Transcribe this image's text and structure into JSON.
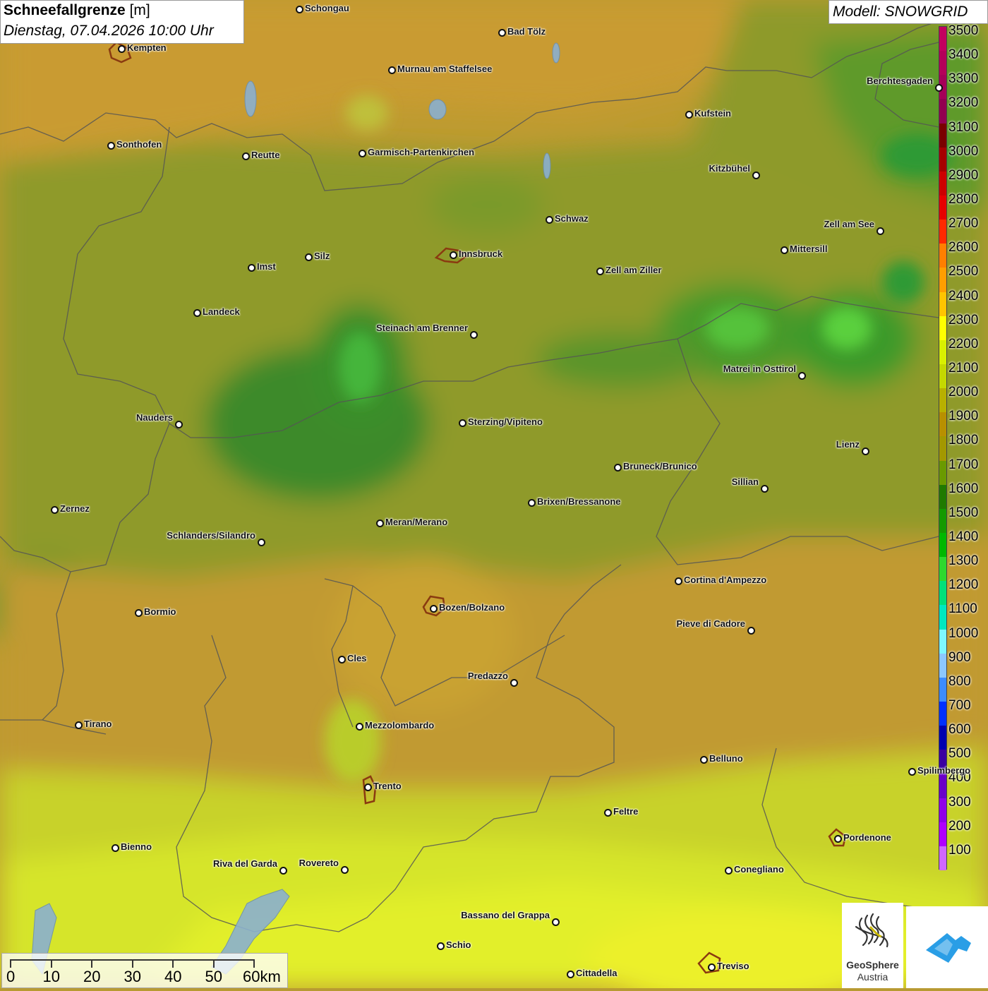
{
  "header": {
    "title": "Schneefallgrenze",
    "unit": "[m]",
    "datetime": "Dienstag, 07.04.2026 10:00 Uhr"
  },
  "model": {
    "label": "Modell: SNOWGRID"
  },
  "legend": {
    "labels": [
      "3500",
      "3400",
      "3300",
      "3200",
      "3100",
      "3000",
      "2900",
      "2800",
      "2700",
      "2600",
      "2500",
      "2400",
      "2300",
      "2200",
      "2100",
      "2000",
      "1900",
      "1800",
      "1700",
      "1600",
      "1500",
      "1400",
      "1300",
      "1200",
      "1100",
      "1000",
      "900",
      "800",
      "700",
      "600",
      "500",
      "400",
      "300",
      "200",
      "100"
    ],
    "colors": [
      "#c2005f",
      "#b4005a",
      "#a50058",
      "#920050",
      "#7a0000",
      "#a60000",
      "#cc0000",
      "#e60000",
      "#ff2a00",
      "#ff7f00",
      "#ff9e00",
      "#ffc400",
      "#ffff00",
      "#d8f000",
      "#c4d800",
      "#b8b000",
      "#b89000",
      "#a39800",
      "#6a9a00",
      "#207a00",
      "#149a00",
      "#00b800",
      "#2ed82e",
      "#00e07a",
      "#00e8c0",
      "#7ef8ff",
      "#8cc8ff",
      "#3c8cff",
      "#0030ff",
      "#0000b0",
      "#3a00a0",
      "#6a00c8",
      "#9000e8",
      "#b000ff",
      "#d066ff"
    ]
  },
  "cities": [
    {
      "name": "Schongau",
      "pos": "right"
    },
    {
      "name": "Bad Tölz",
      "pos": "right"
    },
    {
      "name": "Kempten",
      "pos": "right"
    },
    {
      "name": "Murnau am Staffelsee",
      "pos": "right"
    },
    {
      "name": "Berchtesgaden",
      "pos": "left"
    },
    {
      "name": "Kufstein",
      "pos": "right"
    },
    {
      "name": "Sonthofen",
      "pos": "right"
    },
    {
      "name": "Reutte",
      "pos": "right"
    },
    {
      "name": "Garmisch-Partenkirchen",
      "pos": "right"
    },
    {
      "name": "Kitzbühel",
      "pos": "left"
    },
    {
      "name": "Schwaz",
      "pos": "right"
    },
    {
      "name": "Zell am See",
      "pos": "left"
    },
    {
      "name": "Innsbruck",
      "pos": "right"
    },
    {
      "name": "Silz",
      "pos": "right"
    },
    {
      "name": "Mittersill",
      "pos": "right"
    },
    {
      "name": "Imst",
      "pos": "right"
    },
    {
      "name": "Zell am Ziller",
      "pos": "right"
    },
    {
      "name": "Landeck",
      "pos": "right"
    },
    {
      "name": "Steinach am Brenner",
      "pos": "left"
    },
    {
      "name": "Matrei in Osttirol",
      "pos": "left"
    },
    {
      "name": "Nauders",
      "pos": "left"
    },
    {
      "name": "Sterzing/Vipiteno",
      "pos": "right"
    },
    {
      "name": "Lienz",
      "pos": "left"
    },
    {
      "name": "Bruneck/Brunico",
      "pos": "right"
    },
    {
      "name": "Sillian",
      "pos": "left"
    },
    {
      "name": "Zernez",
      "pos": "right"
    },
    {
      "name": "Brixen/Bressanone",
      "pos": "right"
    },
    {
      "name": "Meran/Merano",
      "pos": "right"
    },
    {
      "name": "Schlanders/Silandro",
      "pos": "left"
    },
    {
      "name": "Cortina d'Ampezzo",
      "pos": "right"
    },
    {
      "name": "Bozen/Bolzano",
      "pos": "right"
    },
    {
      "name": "Bormio",
      "pos": "right"
    },
    {
      "name": "Pieve di Cadore",
      "pos": "left"
    },
    {
      "name": "Cles",
      "pos": "right"
    },
    {
      "name": "Predazzo",
      "pos": "left"
    },
    {
      "name": "Tirano",
      "pos": "right"
    },
    {
      "name": "Mezzolombardo",
      "pos": "right"
    },
    {
      "name": "Belluno",
      "pos": "right"
    },
    {
      "name": "Spilimbergo",
      "pos": "right"
    },
    {
      "name": "Trento",
      "pos": "right"
    },
    {
      "name": "Feltre",
      "pos": "right"
    },
    {
      "name": "Pordenone",
      "pos": "right"
    },
    {
      "name": "Bienno",
      "pos": "right"
    },
    {
      "name": "Riva del Garda",
      "pos": "left"
    },
    {
      "name": "Rovereto",
      "pos": "left"
    },
    {
      "name": "Conegliano",
      "pos": "right"
    },
    {
      "name": "Bassano del Grappa",
      "pos": "left"
    },
    {
      "name": "Schio",
      "pos": "right"
    },
    {
      "name": "Treviso",
      "pos": "right"
    },
    {
      "name": "Cittadella",
      "pos": "right"
    }
  ],
  "scale": {
    "labels": [
      "0",
      "10",
      "20",
      "30",
      "40",
      "50",
      "60km"
    ]
  },
  "logos": {
    "geosphere_line1": "GeoSphere",
    "geosphere_line2": "Austria"
  }
}
